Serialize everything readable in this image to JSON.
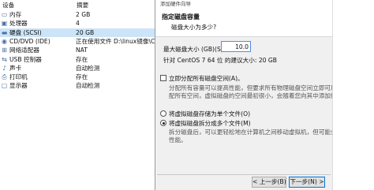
{
  "hardware_list": {
    "headers": {
      "device": "设备",
      "summary": "摘要"
    },
    "items": [
      {
        "icon": "memory-icon",
        "glyph": "▭",
        "name": "内存",
        "summary": "2 GB"
      },
      {
        "icon": "processor-icon",
        "glyph": "▣",
        "name": "处理器",
        "summary": "4"
      },
      {
        "icon": "hard-disk-icon",
        "glyph": "▬",
        "name": "硬盘 (SCSI)",
        "summary": "20 GB",
        "selected": true
      },
      {
        "icon": "cd-dvd-icon",
        "glyph": "◉",
        "name": "CD/DVD (IDE)",
        "summary": "正在使用文件 D:\\linux镜像\\C..."
      },
      {
        "icon": "network-adapter-icon",
        "glyph": "⊞",
        "name": "网络适配器",
        "summary": "NAT"
      },
      {
        "icon": "usb-controller-icon",
        "glyph": "⇆",
        "name": "USB 控制器",
        "summary": "存在"
      },
      {
        "icon": "sound-card-icon",
        "glyph": "♪",
        "name": "声卡",
        "summary": "自动检测"
      },
      {
        "icon": "printer-icon",
        "glyph": "⎙",
        "name": "打印机",
        "summary": "存在"
      },
      {
        "icon": "display-icon",
        "glyph": "▢",
        "name": "显示器",
        "summary": "自动检测"
      }
    ]
  },
  "wizard": {
    "window_title": "添加硬件向导",
    "page_title": "指定磁盘容量",
    "page_subtitle": "磁盘大小为多少?",
    "size_label": "最大磁盘大小 (GB)(S):",
    "size_value": "10.0",
    "recommendation": "针对 CentOS 7 64 位 的建议大小: 20 GB",
    "allocate_now": {
      "label": "立即分配所有磁盘空间(A)。",
      "checked": false,
      "description": [
        "分配所有容量可以提高性能，但要求所有物理磁盘空间立即可用。如果不立即分",
        "配所有空间，虚拟磁盘的空间最初很小，会随着您向其中添加数据而不断变大。"
      ]
    },
    "disk_split": {
      "single_label": "将虚拟磁盘存储为单个文件(O)",
      "multi_label": "将虚拟磁盘拆分成多个文件(M)",
      "selected": "multi",
      "description": [
        "拆分磁盘后，可以更轻松地在计算机之间移动虚拟机，但可能会降低大容量磁盘的",
        "性能。"
      ]
    },
    "buttons": {
      "back": "< 上一步(B)",
      "next": "下一步(N) >"
    }
  }
}
